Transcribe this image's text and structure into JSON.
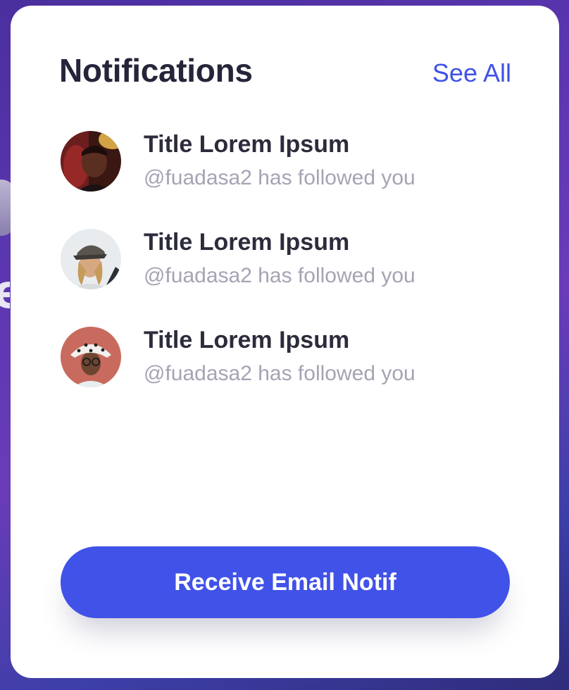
{
  "panel": {
    "title": "Notifications",
    "see_all_label": "See All"
  },
  "notifications": [
    {
      "title": "Title Lorem Ipsum",
      "subtitle": "@fuadasa2 has followed you",
      "avatar_icon": "person-avatar-red-cap"
    },
    {
      "title": "Title Lorem Ipsum",
      "subtitle": "@fuadasa2 has followed you",
      "avatar_icon": "person-avatar-grey-cap"
    },
    {
      "title": "Title Lorem Ipsum",
      "subtitle": "@fuadasa2 has followed you",
      "avatar_icon": "person-avatar-bucket-hat"
    }
  ],
  "footer": {
    "button_label": "Receive Email Notif"
  },
  "colors": {
    "accent": "#4152e8",
    "title_text": "#25253a",
    "secondary_text": "#a4a4b4",
    "card_bg": "#ffffff"
  }
}
